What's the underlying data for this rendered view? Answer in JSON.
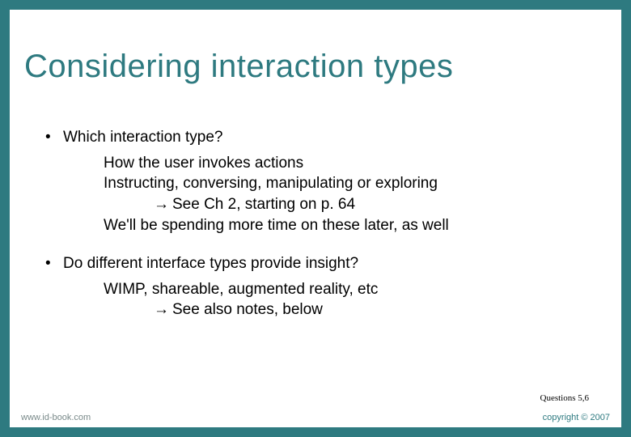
{
  "title": "Considering interaction types",
  "bullets": [
    {
      "text": "Which interaction type?",
      "subs": [
        {
          "text": "How the user invokes actions"
        },
        {
          "text": "Instructing, conversing, manipulating or exploring"
        },
        {
          "text": "See Ch 2, starting on p. 64",
          "arrow": true,
          "depth": 2
        },
        {
          "text": "We'll be spending more time on these later, as well"
        }
      ]
    },
    {
      "text": "Do different interface types provide insight?",
      "subs": [
        {
          "text": "WIMP, shareable, augmented reality, etc"
        },
        {
          "text": "See also notes, below",
          "arrow": true,
          "depth": 2
        }
      ]
    }
  ],
  "arrow_char": "→",
  "bullet_char": "•",
  "questions_note": "Questions 5,6",
  "footer": {
    "left": "www.id-book.com",
    "right": "copyright © 2007"
  }
}
